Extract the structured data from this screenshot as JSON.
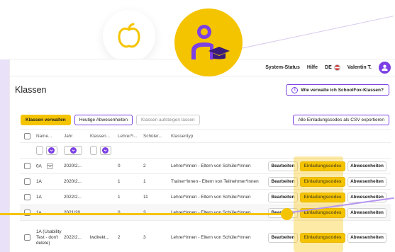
{
  "topbar": {
    "system_status": "System-Status",
    "help": "Hilfe",
    "language": "DE",
    "user_name": "Valentin T."
  },
  "page": {
    "title": "Klassen",
    "help_link": "Wie verwalte ich SchoolFox-Klassen?"
  },
  "tabs": {
    "manage": "Klassen verwalten",
    "absences_today": "Heutige Abwesenheiten",
    "promote": "Klassen aufsteigen lassen",
    "export": "Alle Einladungscodes als CSV exportieren"
  },
  "table": {
    "headers": {
      "name": "Name...",
      "year": "Jahr",
      "class_teacher": "Klassen...",
      "teachers": "Lehrer*i...",
      "students": "Schüler...",
      "type": "Klassentyp"
    },
    "actions": {
      "edit": "Bearbeiten",
      "invite": "Einladungscodes",
      "absences": "Abwesenheiten"
    },
    "rows": [
      {
        "name": "0A",
        "year": "2020/2...",
        "class_teacher": "",
        "teachers": "0",
        "students": "2",
        "type": "Lehrer*innen - Eltern von Schüler*innen"
      },
      {
        "name": "1A",
        "year": "2020/2...",
        "class_teacher": "",
        "teachers": "1",
        "students": "1",
        "type": "Trainer*innen - Eltern von Teilnehmer*innen"
      },
      {
        "name": "1A",
        "year": "2022/2...",
        "class_teacher": "",
        "teachers": "1",
        "students": "11",
        "type": "Lehrer*innen - Eltern von Schüler*innen"
      },
      {
        "name": "1a",
        "year": "2021/20...",
        "class_teacher": "",
        "teachers": "0",
        "students": "3",
        "type": "Lehrer*innen - Eltern von Schüler*innen"
      },
      {
        "name": "1A (Usability Test - don't delete)",
        "year": "2022/2...",
        "class_teacher": "lwdirekt...",
        "teachers": "2",
        "students": "3",
        "type": "Lehrer*innen - Eltern von Schüler*innen"
      }
    ]
  },
  "colors": {
    "accent": "#7b3fe4",
    "highlight": "#f5c400"
  }
}
